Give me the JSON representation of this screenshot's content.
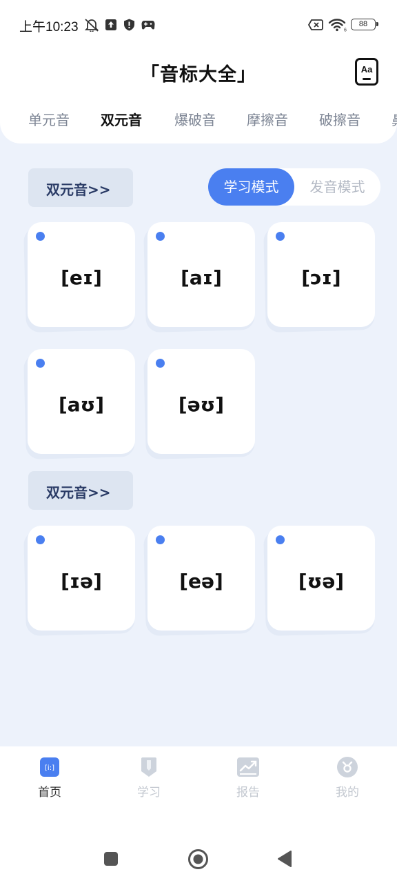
{
  "status_bar": {
    "time": "上午10:23",
    "battery": "88"
  },
  "header": {
    "title": "「音标大全」",
    "font_button_label": "Aa"
  },
  "tabs": [
    {
      "label": "单元音",
      "active": false
    },
    {
      "label": "双元音",
      "active": true
    },
    {
      "label": "爆破音",
      "active": false
    },
    {
      "label": "摩擦音",
      "active": false
    },
    {
      "label": "破擦音",
      "active": false
    },
    {
      "label": "鼻",
      "active": false
    }
  ],
  "mode_toggle": {
    "study_mode": "学习模式",
    "pronounce_mode": "发音模式"
  },
  "sections": [
    {
      "label": "双元音>>",
      "phonemes": [
        "[eɪ]",
        "[aɪ]",
        "[ɔɪ]",
        "[aʊ]",
        "[əʊ]"
      ]
    },
    {
      "label": "双元音>>",
      "phonemes": [
        "[ɪə]",
        "[eə]",
        "[ʊə]"
      ]
    }
  ],
  "bottom_nav": {
    "items": [
      {
        "label": "首页",
        "icon": "ipa-icon",
        "active": true
      },
      {
        "label": "学习",
        "icon": "bookmark-icon",
        "active": false
      },
      {
        "label": "报告",
        "icon": "chart-icon",
        "active": false
      },
      {
        "label": "我的",
        "icon": "profile-icon",
        "active": false
      }
    ],
    "home_icon_text": "[i:]"
  },
  "colors": {
    "accent": "#4a7ff0",
    "background": "#edf2fb",
    "section_label_text": "#2a3b66",
    "inactive_text": "#c3c8d0"
  }
}
